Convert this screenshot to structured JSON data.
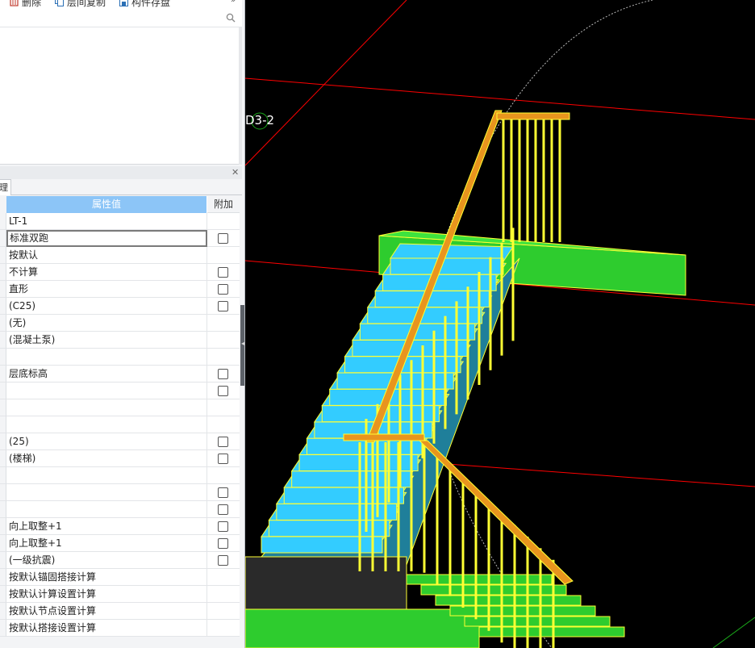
{
  "toolbar": {
    "delete_label": "删除",
    "copy_floor_label": "层间复制",
    "save_component_label": "构件存盘"
  },
  "properties": {
    "tab_label": "理",
    "header_value": "属性值",
    "header_addon": "附加",
    "rows": [
      {
        "value": "LT-1",
        "checkbox": false
      },
      {
        "value": "标准双跑",
        "checkbox": true,
        "editing": true
      },
      {
        "value": "按默认",
        "checkbox": false
      },
      {
        "value": "不计算",
        "checkbox": true
      },
      {
        "value": "直形",
        "checkbox": true
      },
      {
        "value": "(C25)",
        "checkbox": true
      },
      {
        "value": "(无)",
        "checkbox": false
      },
      {
        "value": "(混凝土泵)",
        "checkbox": false
      },
      {
        "value": "",
        "checkbox": false
      },
      {
        "value": "层底标高",
        "checkbox": true
      },
      {
        "value": "",
        "checkbox": true
      },
      {
        "value": "",
        "checkbox": false
      },
      {
        "value": "",
        "checkbox": false
      },
      {
        "value": "(25)",
        "checkbox": true
      },
      {
        "value": "(楼梯)",
        "checkbox": true
      },
      {
        "value": "",
        "checkbox": false
      },
      {
        "value": "",
        "checkbox": true
      },
      {
        "value": "",
        "checkbox": true
      },
      {
        "value": "向上取整+1",
        "checkbox": true
      },
      {
        "value": "向上取整+1",
        "checkbox": true
      },
      {
        "value": "(一级抗震)",
        "checkbox": true
      },
      {
        "value": "按默认锚固搭接计算",
        "checkbox": false
      },
      {
        "value": "按默认计算设置计算",
        "checkbox": false
      },
      {
        "value": "按默认节点设置计算",
        "checkbox": false
      },
      {
        "value": "按默认搭接设置计算",
        "checkbox": false
      }
    ]
  },
  "viewport": {
    "axis_label": "D3-2"
  },
  "colors": {
    "header_blue": "#8cc5f7",
    "step_cyan": "#33ccff",
    "beam_green": "#2ecc2e",
    "rail_yellow": "#ffff33",
    "handrail_orange": "#e8951e",
    "grid_red": "#ff0000"
  }
}
